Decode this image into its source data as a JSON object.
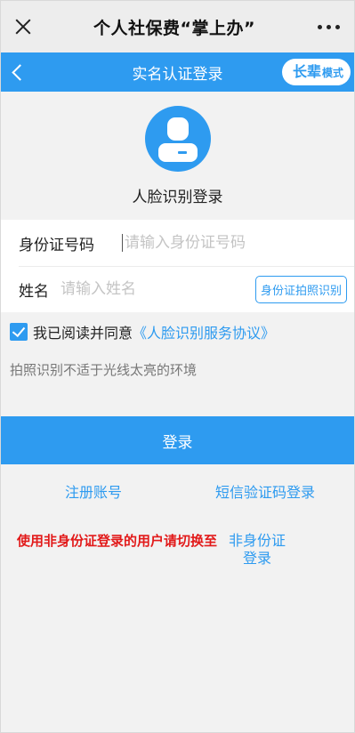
{
  "topbar": {
    "title": "个人社保费“掌上办”",
    "close_icon": "close-icon",
    "more_icon": "more-dots-icon"
  },
  "navbar": {
    "title": "实名认证登录",
    "back_icon": "chevron-left-icon",
    "elder_mode_big": "长辈",
    "elder_mode_small": "模式"
  },
  "face": {
    "icon": "user-avatar-icon",
    "label": "人脸识别登录"
  },
  "form": {
    "id_label": "身份证号码",
    "id_value": "",
    "id_placeholder": "请输入身份证号码",
    "name_label": "姓名",
    "name_value": "",
    "name_placeholder": "请输入姓名",
    "scan_button": "身份证拍照识别"
  },
  "agreement": {
    "checked": true,
    "text": "我已阅读并同意",
    "link": "《人脸识别服务协议》"
  },
  "tip": "拍照识别不适于光线太亮的环境",
  "login_button": "登录",
  "links": {
    "register": "注册账号",
    "sms_login": "短信验证码登录"
  },
  "notice": {
    "text": "使用非身份证登录的用户请切换至",
    "link": "非身份证登录"
  },
  "colors": {
    "accent": "#2e9bf0",
    "warning": "#e21a1a"
  }
}
